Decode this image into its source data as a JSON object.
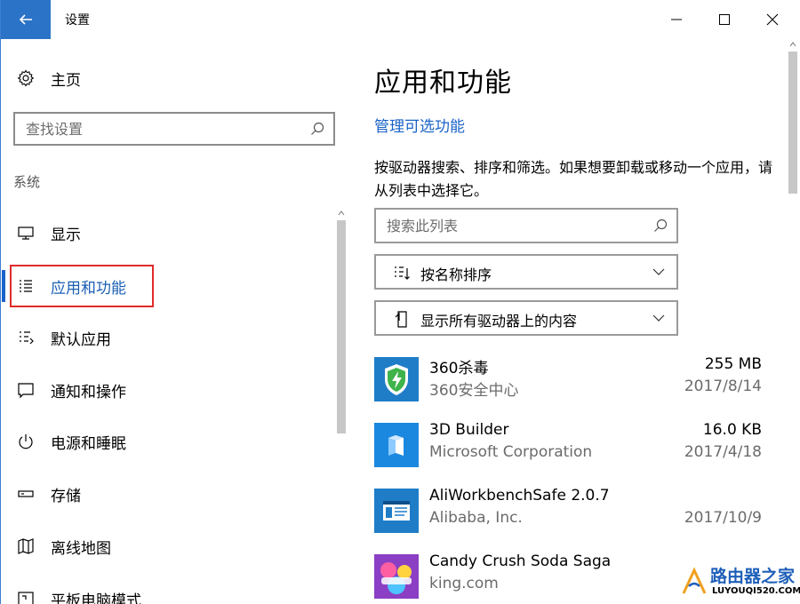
{
  "window": {
    "title": "设置",
    "colors": {
      "accent": "#2b73c7",
      "link": "#1a63c8",
      "highlight": "#e02b2b"
    }
  },
  "sidebar": {
    "home_label": "主页",
    "search_placeholder": "查找设置",
    "section_label": "系统",
    "items": [
      {
        "label": "显示",
        "icon": "monitor-icon"
      },
      {
        "label": "应用和功能",
        "icon": "apps-list-icon",
        "active": true
      },
      {
        "label": "默认应用",
        "icon": "default-apps-icon"
      },
      {
        "label": "通知和操作",
        "icon": "notification-icon"
      },
      {
        "label": "电源和睡眠",
        "icon": "power-icon"
      },
      {
        "label": "存储",
        "icon": "storage-icon"
      },
      {
        "label": "离线地图",
        "icon": "map-icon"
      },
      {
        "label": "平板电脑模式",
        "icon": "tablet-mode-icon"
      }
    ]
  },
  "main": {
    "title": "应用和功能",
    "optional_features_link": "管理可选功能",
    "description": "按驱动器搜索、排序和筛选。如果想要卸载或移动一个应用，请从列表中选择它。",
    "list_search_placeholder": "搜索此列表",
    "sort_dropdown": "按名称排序",
    "drive_dropdown": "显示所有驱动器上的内容",
    "apps": [
      {
        "name": "360杀毒",
        "publisher": "360安全中心",
        "size": "255 MB",
        "date": "2017/8/14",
        "icon": "360-antivirus-icon"
      },
      {
        "name": "3D Builder",
        "publisher": "Microsoft Corporation",
        "size": "16.0 KB",
        "date": "2017/4/18",
        "icon": "3d-builder-icon"
      },
      {
        "name": "AliWorkbenchSafe 2.0.7",
        "publisher": "Alibaba, Inc.",
        "size": "",
        "date": "2017/10/9",
        "icon": "aliworkbench-icon"
      },
      {
        "name": "Candy Crush Soda Saga",
        "publisher": "king.com",
        "size": "",
        "date": "",
        "icon": "candy-crush-icon"
      }
    ]
  },
  "watermark": {
    "text": "路由器之家",
    "url": "LUYOUQI520.COM"
  }
}
